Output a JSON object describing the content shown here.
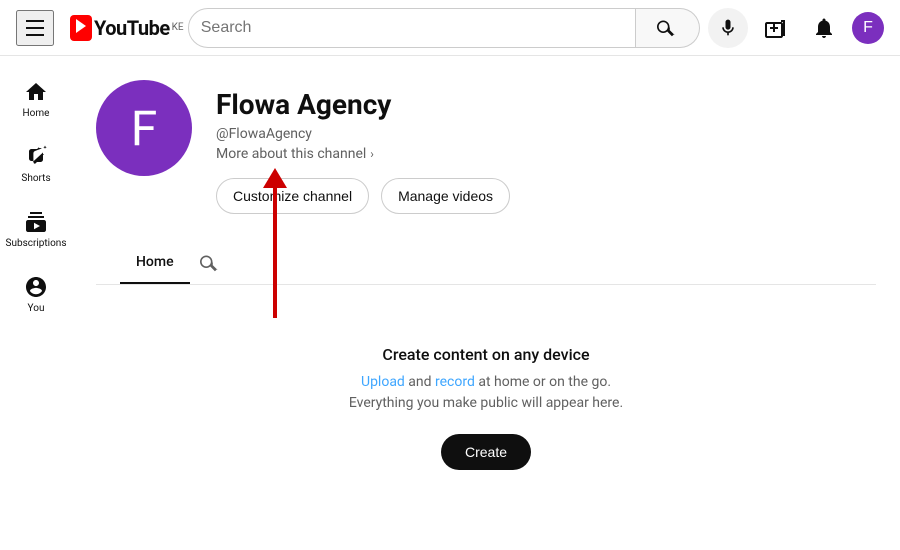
{
  "header": {
    "logo_text": "YouTube",
    "logo_country": "KE",
    "search_placeholder": "Search",
    "create_icon_label": "Create",
    "notifications_label": "Notifications",
    "avatar_letter": "F"
  },
  "sidebar": {
    "items": [
      {
        "id": "home",
        "label": "Home"
      },
      {
        "id": "shorts",
        "label": "Shorts"
      },
      {
        "id": "subscriptions",
        "label": "Subscriptions"
      },
      {
        "id": "you",
        "label": "You"
      }
    ]
  },
  "channel": {
    "avatar_letter": "F",
    "name": "Flowa Agency",
    "handle": "@FlowaAgency",
    "more_label": "More about this channel",
    "actions": {
      "customize": "Customize channel",
      "manage": "Manage videos"
    },
    "tabs": {
      "home": "Home",
      "search_aria": "Search channel"
    }
  },
  "empty_state": {
    "title": "Create content on any device",
    "desc_line1_pre": "Upload and record",
    "desc_link1": "Upload",
    "desc_link2": "record",
    "desc_line1_mid": " at home or on the go.",
    "desc_line2": "Everything you make public will appear here.",
    "create_btn": "Create"
  }
}
